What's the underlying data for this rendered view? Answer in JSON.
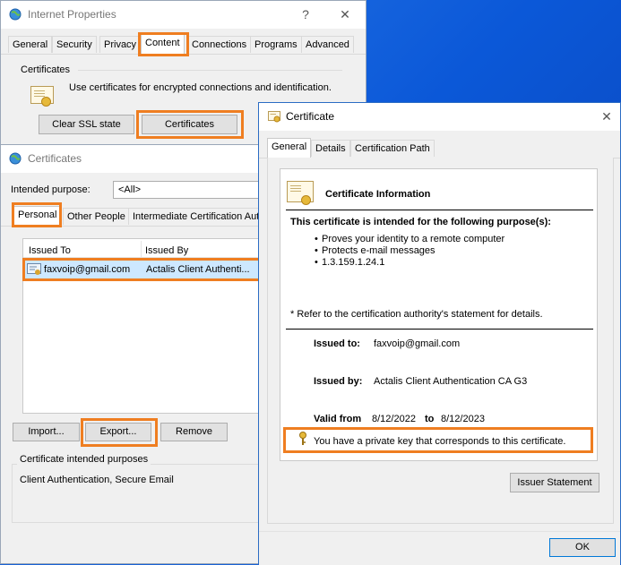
{
  "internet_properties": {
    "title": "Internet Properties",
    "help": "?",
    "close": "✕",
    "tabs": [
      "General",
      "Security",
      "Privacy",
      "Content",
      "Connections",
      "Programs",
      "Advanced"
    ],
    "certificates_group": "Certificates",
    "certificates_desc": "Use certificates for encrypted connections and identification.",
    "clear_ssl_label": "Clear SSL state",
    "certificates_label": "Certificates"
  },
  "certificates_dialog": {
    "title": "Certificates",
    "intended_purpose_label": "Intended purpose:",
    "intended_purpose_value": "<All>",
    "tabs": [
      "Personal",
      "Other People",
      "Intermediate Certification Aut"
    ],
    "columns": [
      "Issued To",
      "Issued By"
    ],
    "rows": [
      {
        "issued_to": "faxvoip@gmail.com",
        "issued_by": "Actalis Client Authenti..."
      }
    ],
    "import_label": "Import...",
    "export_label": "Export...",
    "remove_label": "Remove",
    "purposes_group": "Certificate intended purposes",
    "purposes_value": "Client Authentication, Secure Email"
  },
  "certificate": {
    "title": "Certificate",
    "close": "✕",
    "tabs": [
      "General",
      "Details",
      "Certification Path"
    ],
    "info_heading": "Certificate Information",
    "purpose_heading": "This certificate is intended for the following purpose(s):",
    "purposes": [
      "Proves your identity to a remote computer",
      "Protects e-mail messages",
      "1.3.159.1.24.1"
    ],
    "refer_note": "* Refer to the certification authority's statement for details.",
    "issued_to_label": "Issued to:",
    "issued_to_value": "faxvoip@gmail.com",
    "issued_by_label": "Issued by:",
    "issued_by_value": "Actalis Client Authentication CA G3",
    "valid_from_label": "Valid from",
    "valid_from_value": "8/12/2022",
    "valid_to_label": "to",
    "valid_to_value": "8/12/2023",
    "private_key_text": "You have a private key that corresponds to this certificate.",
    "issuer_statement_label": "Issuer Statement",
    "ok_label": "OK"
  },
  "colors": {
    "highlight": "#ef7e21",
    "desktop": "#0b58d8"
  }
}
